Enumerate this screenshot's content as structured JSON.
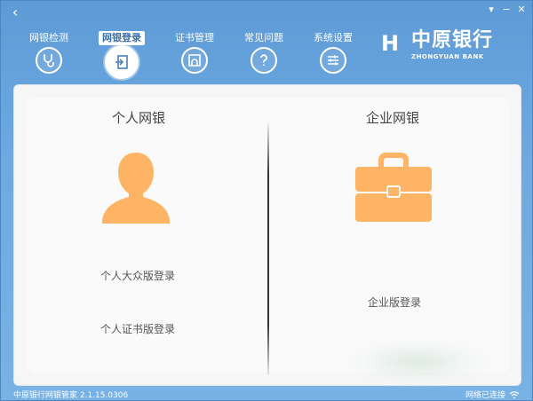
{
  "nav": {
    "items": [
      {
        "label": "网银检测",
        "icon": "stethoscope-icon"
      },
      {
        "label": "网银登录",
        "icon": "login-door-icon",
        "active": true
      },
      {
        "label": "证书管理",
        "icon": "certificate-icon"
      },
      {
        "label": "常见问题",
        "icon": "question-icon"
      },
      {
        "label": "系统设置",
        "icon": "settings-sliders-icon"
      }
    ]
  },
  "brand": {
    "name": "中原银行",
    "sub": "ZHONGYUAN BANK",
    "logo": "H"
  },
  "personal": {
    "title": "个人网银",
    "icon": "person-icon",
    "links": [
      "个人大众版登录",
      "个人证书版登录"
    ]
  },
  "enterprise": {
    "title": "企业网银",
    "icon": "briefcase-icon",
    "links": [
      "企业版登录"
    ]
  },
  "status": {
    "left": "中原银行网银管家 2.1.15.0306",
    "right": "网络已连接"
  },
  "colors": {
    "accent": "#6aa6dc",
    "icon_fill": "#fdb565"
  }
}
